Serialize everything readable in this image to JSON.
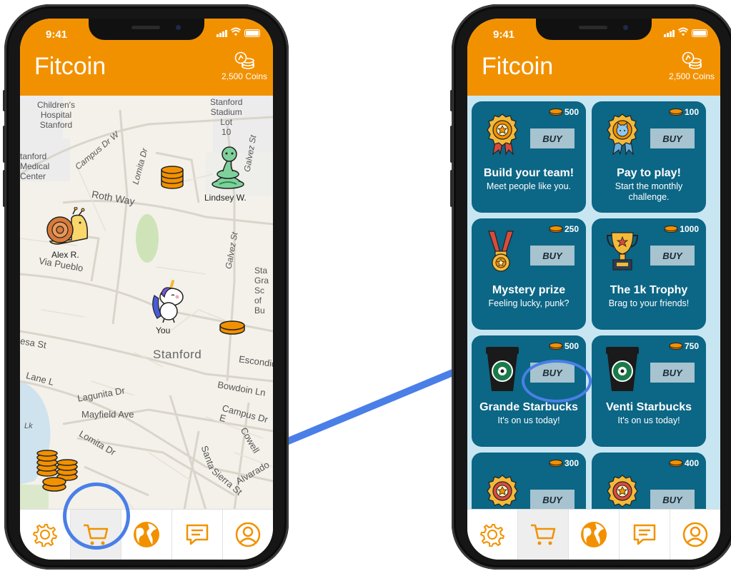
{
  "status": {
    "time": "9:41"
  },
  "app": {
    "title": "Fitcoin",
    "coins": "2,500 Coins"
  },
  "map": {
    "labels": [
      {
        "text": "Children's\nHospital\nStanford"
      },
      {
        "text": "Stanford\nStadium\nLot\n10"
      },
      {
        "text": "Campus Dr W"
      },
      {
        "text": "tanford\nMedical\nCenter"
      },
      {
        "text": "Lomita Dr"
      },
      {
        "text": "Galvez St"
      },
      {
        "text": "Roth Way"
      },
      {
        "text": "Via Pueblo"
      },
      {
        "text": "Galvez St"
      },
      {
        "text": "Sta\nGra\nSc\nof Bu"
      },
      {
        "text": "Stanford"
      },
      {
        "text": "Escondid"
      },
      {
        "text": "esa St"
      },
      {
        "text": "Lane L"
      },
      {
        "text": "Bowdoin Ln"
      },
      {
        "text": "Lagunita Dr"
      },
      {
        "text": "Mayfield Ave"
      },
      {
        "text": "Campus Dr E"
      },
      {
        "text": "Lomita Dr"
      },
      {
        "text": "Cowell"
      },
      {
        "text": "Lk"
      },
      {
        "text": "Alvarado"
      },
      {
        "text": "Sierra St"
      },
      {
        "text": "Santa"
      }
    ],
    "users": [
      {
        "name": "Lindsey W."
      },
      {
        "name": "Alex R."
      },
      {
        "name": "You"
      }
    ]
  },
  "nav": {
    "tabs": [
      {
        "icon": "gear-icon"
      },
      {
        "icon": "cart-icon"
      },
      {
        "icon": "globe-icon"
      },
      {
        "icon": "chat-icon"
      },
      {
        "icon": "profile-icon"
      }
    ]
  },
  "shop": {
    "buy_label": "BUY",
    "items": [
      {
        "cost": "500",
        "title": "Build your team!",
        "subtitle": "Meet people like you.",
        "icon": "ribbon-badge-icon"
      },
      {
        "cost": "100",
        "title": "Pay to play!",
        "subtitle": "Start the monthly challenge.",
        "icon": "cat-badge-icon"
      },
      {
        "cost": "250",
        "title": "Mystery prize",
        "subtitle": "Feeling lucky, punk?",
        "icon": "medal-icon"
      },
      {
        "cost": "1000",
        "title": "The 1k Trophy",
        "subtitle": "Brag to your friends!",
        "icon": "trophy-icon"
      },
      {
        "cost": "500",
        "title": "Grande Starbucks",
        "subtitle": "It's on us today!",
        "icon": "coffee-cup-icon"
      },
      {
        "cost": "750",
        "title": "Venti Starbucks",
        "subtitle": "It's on us today!",
        "icon": "coffee-cup-icon"
      },
      {
        "cost": "300",
        "title": "",
        "subtitle": "",
        "icon": "ribbon-badge-icon"
      },
      {
        "cost": "400",
        "title": "",
        "subtitle": "",
        "icon": "ribbon-badge-icon"
      }
    ]
  },
  "colors": {
    "brand": "#f29100",
    "card": "#0c6685",
    "shop_bg": "#c8e6f2",
    "highlight": "#4a7fe8"
  }
}
